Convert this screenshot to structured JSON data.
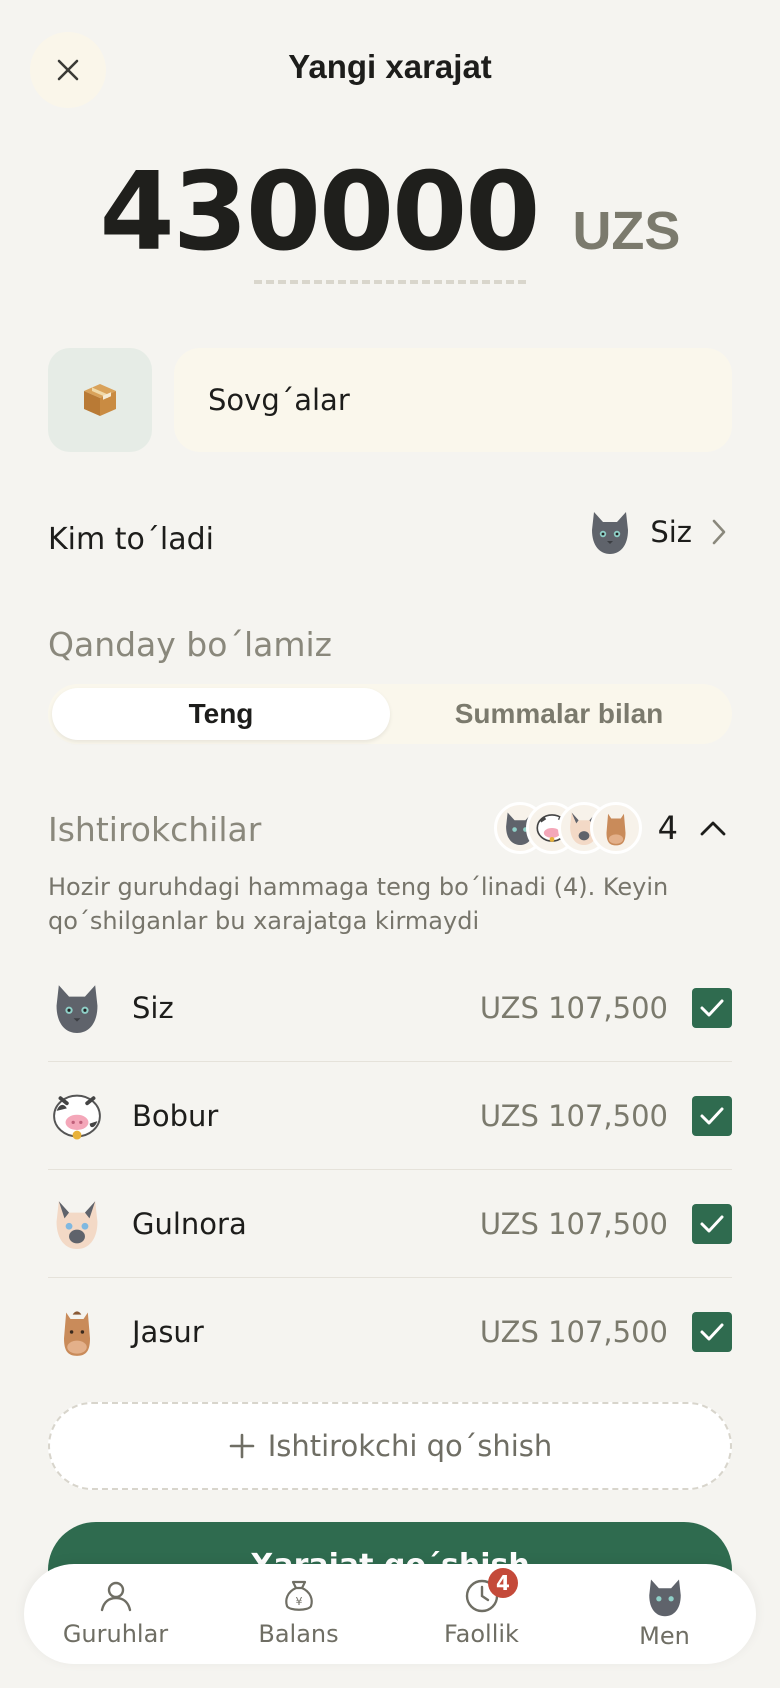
{
  "header": {
    "title": "Yangi xarajat",
    "close_icon": "close-icon"
  },
  "amount": {
    "value": "430000",
    "currency": "UZS"
  },
  "category": {
    "icon": "package-icon",
    "name": "Sovg´alar"
  },
  "paid_by": {
    "label": "Kim to´ladi",
    "payer_name": "Siz",
    "payer_avatar": "cat-avatar-icon"
  },
  "split": {
    "title": "Qanday bo´lamiz",
    "options": [
      "Teng",
      "Summalar bilan"
    ],
    "selected": "Teng"
  },
  "participants": {
    "title": "Ishtirokchilar",
    "count": "4",
    "note": "Hozir guruhdagi hammaga teng bo´linadi (4). Keyin qo´shilganlar bu xarajatga kirmaydi",
    "list": [
      {
        "name": "Siz",
        "amount": "UZS 107,500",
        "checked": true,
        "avatar": "cat-avatar-icon"
      },
      {
        "name": "Bobur",
        "amount": "UZS 107,500",
        "checked": true,
        "avatar": "cow-avatar-icon"
      },
      {
        "name": "Gulnora",
        "amount": "UZS 107,500",
        "checked": true,
        "avatar": "siamese-cat-avatar-icon"
      },
      {
        "name": "Jasur",
        "amount": "UZS 107,500",
        "checked": true,
        "avatar": "horse-avatar-icon"
      }
    ],
    "add_label": "Ishtirokchi qo´shish"
  },
  "primary_button": {
    "label": "Xarajat qo´shish"
  },
  "bottom_nav": [
    {
      "label": "Guruhlar",
      "icon": "person-icon"
    },
    {
      "label": "Balans",
      "icon": "money-bag-icon"
    },
    {
      "label": "Faollik",
      "icon": "clock-icon",
      "badge": "4"
    },
    {
      "label": "Men",
      "icon": "cat-avatar-icon"
    }
  ],
  "colors": {
    "background": "#f5f4f0",
    "accent": "#2f6b4f",
    "badge": "#c44a3a",
    "muted_text": "#7b7a6d"
  }
}
